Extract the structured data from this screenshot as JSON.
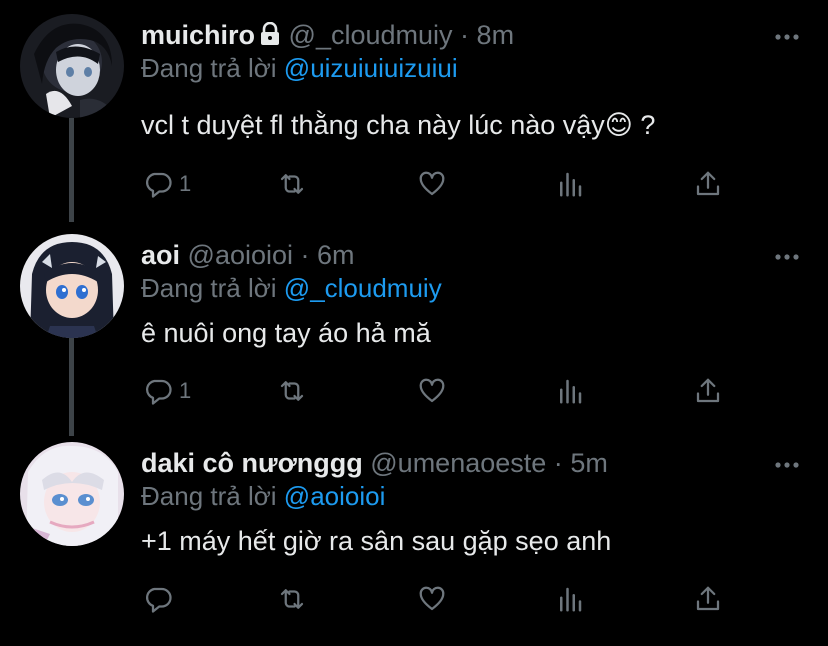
{
  "tweets": [
    {
      "name": "muichiro",
      "handle": "@_cloudmuiy",
      "separator": "·",
      "time": "8m",
      "locked": true,
      "reply_prefix": "Đang trả lời",
      "reply_to": "@uizuiuiuizuiui",
      "text": "vcl t duyệt fl thằng cha này lúc nào vậy😊 ?",
      "reply_count": "1"
    },
    {
      "name": "aoi",
      "handle": "@aoioioi",
      "separator": "·",
      "time": "6m",
      "locked": false,
      "reply_prefix": "Đang trả lời",
      "reply_to": "@_cloudmuiy",
      "text": "ê nuôi ong tay áo hả mă",
      "reply_count": "1"
    },
    {
      "name": "daki cô nươnggg",
      "handle": "@umenaoeste",
      "separator": "·",
      "time": "5m",
      "locked": false,
      "reply_prefix": "Đang trả lời",
      "reply_to": "@aoioioi",
      "text": "+1 máy hết giờ ra sân sau gặp sẹo anh",
      "reply_count": ""
    }
  ],
  "colors": {
    "background": "#000000",
    "text": "#e7e9ea",
    "muted": "#6e767d",
    "link": "#1d9bf0",
    "thread_line": "#3d4348"
  },
  "icons": [
    "reply-icon",
    "retweet-icon",
    "like-icon",
    "analytics-icon",
    "share-icon",
    "more-icon",
    "lock-icon"
  ]
}
